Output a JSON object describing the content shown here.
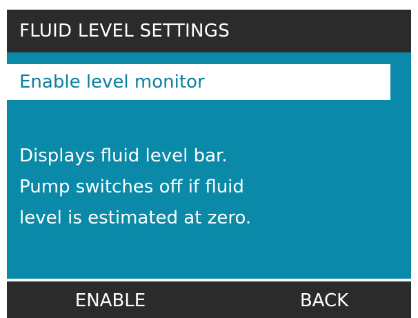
{
  "header": {
    "title": "FLUID LEVEL SETTINGS"
  },
  "menu": {
    "selected_item": "Enable level monitor"
  },
  "description": {
    "lines": [
      "Displays fluid level bar.",
      "Pump switches off if fluid",
      "level is estimated at zero."
    ]
  },
  "softkeys": {
    "left_label": "ENABLE",
    "right_label": "BACK"
  },
  "colors": {
    "screen_background": "#0a8aa8",
    "header_background": "#2b2b2b",
    "footer_background": "#2b2b2b",
    "selection_background": "#ffffff",
    "selection_text": "#0a7fa0",
    "text": "#ffffff"
  }
}
